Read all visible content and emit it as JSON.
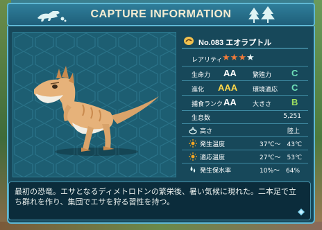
{
  "header": {
    "title": "CAPTURE INFORMATION"
  },
  "creature": {
    "id_name": "No.083 エオラプトル",
    "rarity_label": "レアリティ",
    "rarity_stars_filled": 3,
    "rarity_stars_total": 4
  },
  "stats": [
    {
      "label": "生命力",
      "value": "AA",
      "color": "#ffffff"
    },
    {
      "label": "繁殖力",
      "value": "C",
      "color": "#6fe0b8"
    },
    {
      "label": "進化",
      "value": "AAA",
      "color": "#ffd84a"
    },
    {
      "label": "環境適応",
      "value": "C",
      "color": "#6fe0b8"
    },
    {
      "label": "捕食ランク",
      "value": "AA",
      "color": "#ffffff"
    },
    {
      "label": "大きさ",
      "value": "B",
      "color": "#9fe060"
    }
  ],
  "details": {
    "population_label": "生息数",
    "population_value": "5,251",
    "height_label": "高さ",
    "height_value": "陸上",
    "birth_temp_label": "発生温度",
    "birth_temp_value": "37℃～　43℃",
    "adapt_temp_label": "適応温度",
    "adapt_temp_value": "27℃～　53℃",
    "water_label": "発生保水率",
    "water_value": "10%～　64%"
  },
  "description": "最初の恐竜。エサとなるディメトロドンの繁栄後、暑い気候に現れた。二本足で立ち群れを作り、集団でエサを狩る習性を持つ。",
  "colors": {
    "accent": "#5fb8d4",
    "panel": "#17485a",
    "star": "#f07a3a"
  },
  "icons": [
    "dino-logo-icon",
    "tree-logo-icon",
    "creature-id-icon",
    "sun-icon",
    "water-drop-icon",
    "terrain-icon",
    "diamond-icon"
  ]
}
